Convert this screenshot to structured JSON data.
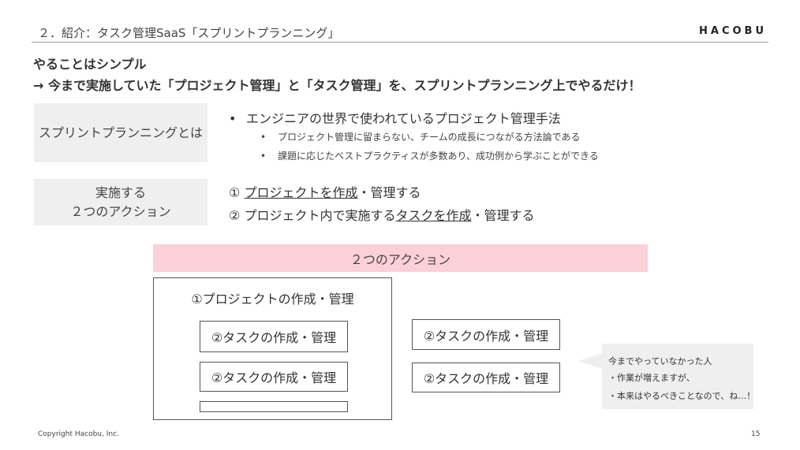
{
  "header": {
    "title": "２．紹介：タスク管理SaaS「スプリントプランニング」",
    "brand": "HACOBU"
  },
  "headline": {
    "line1": "やることはシンプル",
    "line2": "→ 今まで実施していた「プロジェクト管理」と「タスク管理」を、スプリントプランニング上でやるだけ！"
  },
  "section1": {
    "label": "スプリントプランニングとは",
    "bullet_mark": "•",
    "bullet": "エンジニアの世界で使われているプロジェクト管理手法",
    "sub_bullets": [
      "プロジェクト管理に留まらない、チームの成長につながる方法論である",
      "課題に応じたベストプラクティスが多数あり、成功例から学ぶことができる"
    ]
  },
  "section2": {
    "label_line1": "実施する",
    "label_line2": "２つのアクション",
    "action1": {
      "num": "①",
      "underlined": "プロジェクトを作成",
      "rest": "・管理する"
    },
    "action2": {
      "num": "②",
      "pre": "プロジェクト内で実施する",
      "underlined": "タスクを作成",
      "rest": "・管理する"
    }
  },
  "diagram": {
    "banner": "２つのアクション",
    "project_title": "①プロジェクトの作成・管理",
    "task_label": "②タスクの作成・管理"
  },
  "callout": {
    "lines": [
      "今までやっていなかった人",
      "・作業が増えますが、",
      "・本来はやるべきことなので、ね…！"
    ]
  },
  "footer": {
    "copyright": "Copyright Hacobu, Inc.",
    "page_number": "15"
  }
}
